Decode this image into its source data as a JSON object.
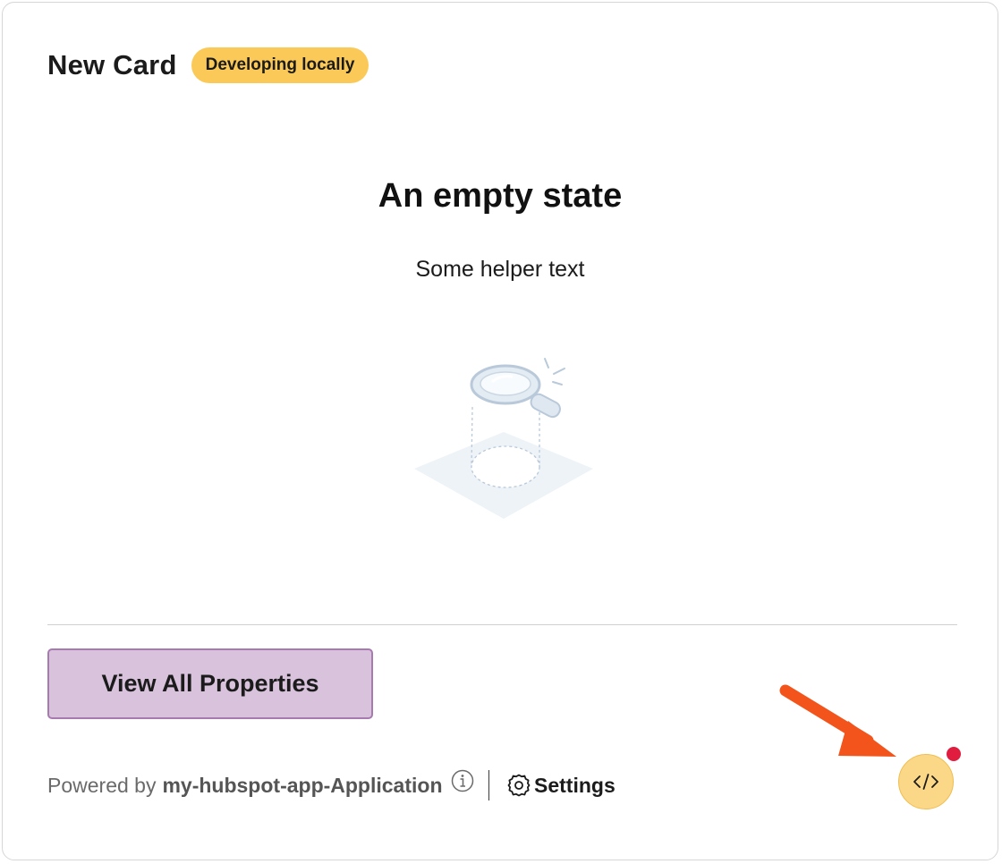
{
  "card": {
    "title": "New Card",
    "badge": "Developing locally"
  },
  "empty_state": {
    "heading": "An empty state",
    "helper": "Some helper text",
    "illustration_icon": "magnifying-glass-empty-icon"
  },
  "actions": {
    "view_all_label": "View All Properties"
  },
  "footer": {
    "powered_by_prefix": "Powered by",
    "app_name": "my-hubspot-app-Application",
    "info_icon": "info-icon",
    "settings_label": "Settings",
    "settings_icon": "gear-icon"
  },
  "dev_tools": {
    "icon": "code-icon",
    "notification_dot_color": "#e11d3f",
    "annotation_arrow_color": "#f2541b"
  },
  "colors": {
    "badge_bg": "#fbc957",
    "button_bg": "#d8c2dc",
    "button_border": "#a77bb0",
    "dev_button_bg": "#fbd887"
  }
}
